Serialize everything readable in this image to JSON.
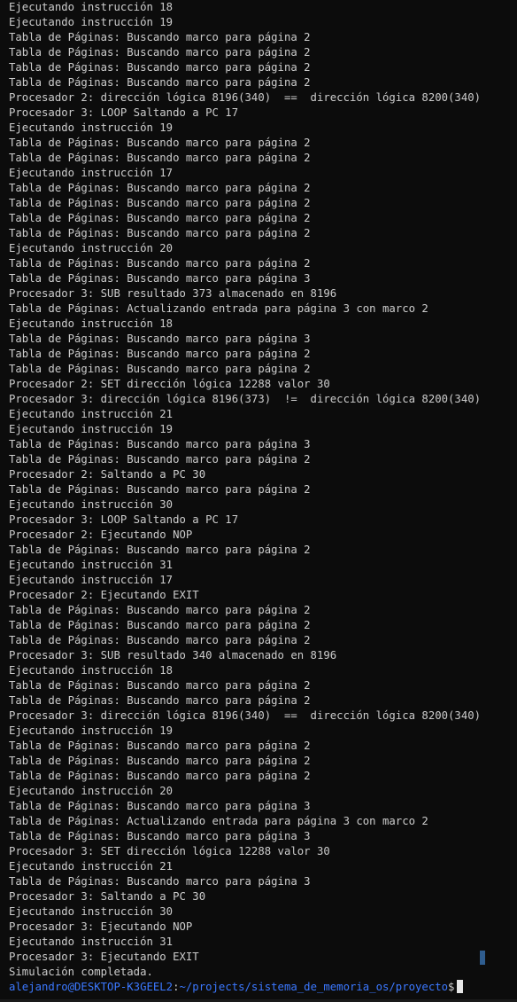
{
  "terminal": {
    "lines": [
      "Ejecutando instrucción 18",
      "Ejecutando instrucción 19",
      "Tabla de Páginas: Buscando marco para página 2",
      "Tabla de Páginas: Buscando marco para página 2",
      "Tabla de Páginas: Buscando marco para página 2",
      "Tabla de Páginas: Buscando marco para página 2",
      "Procesador 2: dirección lógica 8196(340)  ==  dirección lógica 8200(340)",
      "Procesador 3: LOOP Saltando a PC 17",
      "Ejecutando instrucción 19",
      "Tabla de Páginas: Buscando marco para página 2",
      "Tabla de Páginas: Buscando marco para página 2",
      "Ejecutando instrucción 17",
      "Tabla de Páginas: Buscando marco para página 2",
      "Tabla de Páginas: Buscando marco para página 2",
      "Tabla de Páginas: Buscando marco para página 2",
      "Tabla de Páginas: Buscando marco para página 2",
      "Ejecutando instrucción 20",
      "Tabla de Páginas: Buscando marco para página 2",
      "Tabla de Páginas: Buscando marco para página 3",
      "Procesador 3: SUB resultado 373 almacenado en 8196",
      "Tabla de Páginas: Actualizando entrada para página 3 con marco 2",
      "Ejecutando instrucción 18",
      "Tabla de Páginas: Buscando marco para página 3",
      "Tabla de Páginas: Buscando marco para página 2",
      "Tabla de Páginas: Buscando marco para página 2",
      "Procesador 2: SET dirección lógica 12288 valor 30",
      "Procesador 3: dirección lógica 8196(373)  !=  dirección lógica 8200(340)",
      "Ejecutando instrucción 21",
      "Ejecutando instrucción 19",
      "Tabla de Páginas: Buscando marco para página 3",
      "Tabla de Páginas: Buscando marco para página 2",
      "Procesador 2: Saltando a PC 30",
      "Tabla de Páginas: Buscando marco para página 2",
      "Ejecutando instrucción 30",
      "Procesador 3: LOOP Saltando a PC 17",
      "Procesador 2: Ejecutando NOP",
      "Tabla de Páginas: Buscando marco para página 2",
      "Ejecutando instrucción 31",
      "Ejecutando instrucción 17",
      "Procesador 2: Ejecutando EXIT",
      "Tabla de Páginas: Buscando marco para página 2",
      "Tabla de Páginas: Buscando marco para página 2",
      "Tabla de Páginas: Buscando marco para página 2",
      "Procesador 3: SUB resultado 340 almacenado en 8196",
      "Ejecutando instrucción 18",
      "Tabla de Páginas: Buscando marco para página 2",
      "Tabla de Páginas: Buscando marco para página 2",
      "Procesador 3: dirección lógica 8196(340)  ==  dirección lógica 8200(340)",
      "Ejecutando instrucción 19",
      "Tabla de Páginas: Buscando marco para página 2",
      "Tabla de Páginas: Buscando marco para página 2",
      "Tabla de Páginas: Buscando marco para página 2",
      "Ejecutando instrucción 20",
      "Tabla de Páginas: Buscando marco para página 3",
      "Tabla de Páginas: Actualizando entrada para página 3 con marco 2",
      "Tabla de Páginas: Buscando marco para página 3",
      "Procesador 3: SET dirección lógica 12288 valor 30",
      "Ejecutando instrucción 21",
      "Tabla de Páginas: Buscando marco para página 3",
      "Procesador 3: Saltando a PC 30",
      "Ejecutando instrucción 30",
      "Procesador 3: Ejecutando NOP",
      "Ejecutando instrucción 31",
      "Procesador 3: Ejecutando EXIT",
      "Simulación completada."
    ],
    "prompt": {
      "user_host": "alejandro@DESKTOP-K3GEEL2",
      "separator": ":",
      "path": "~/projects/sistema_de_memoria_os/proyecto",
      "symbol": "$"
    },
    "colors": {
      "background": "#0c0c0c",
      "text": "#cccccc",
      "prompt": "#3b78ff",
      "cursor": "#e6e6e6"
    }
  }
}
